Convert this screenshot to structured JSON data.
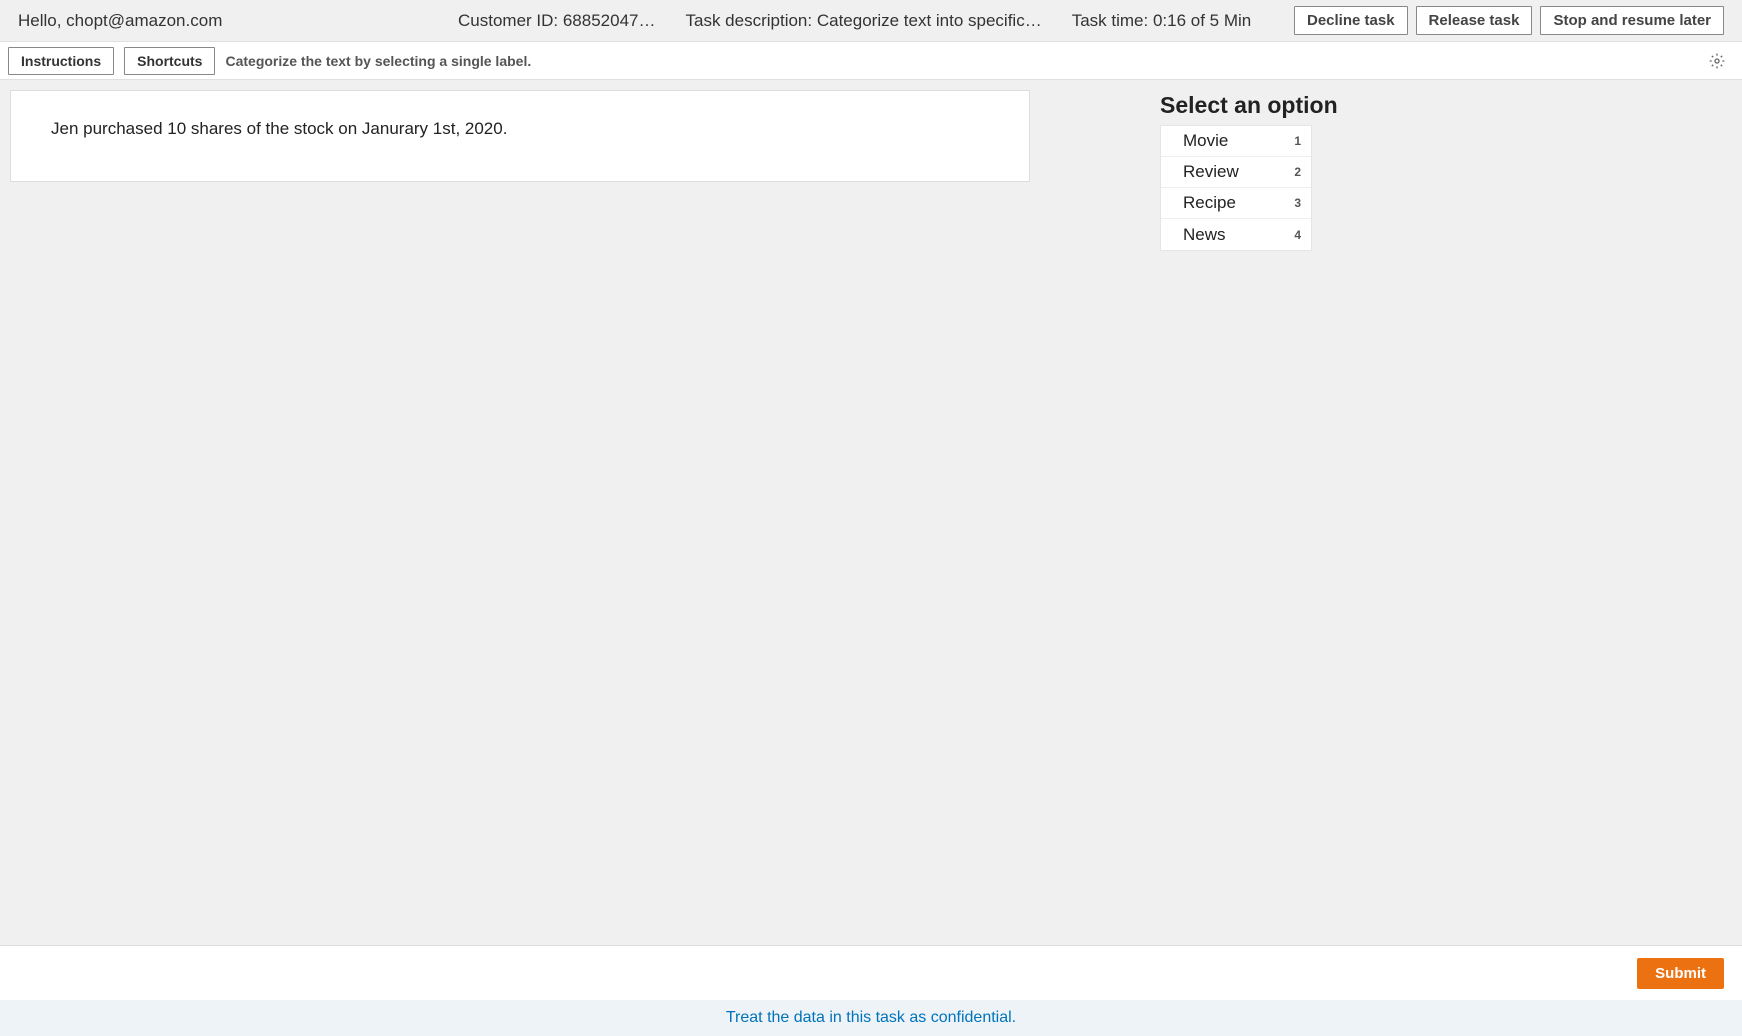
{
  "topbar": {
    "greeting": "Hello, chopt@amazon.com",
    "customer_id": "Customer ID: 68852047…",
    "task_description": "Task description: Categorize text into specific…",
    "task_time": "Task time: 0:16 of 5 Min",
    "decline_label": "Decline task",
    "release_label": "Release task",
    "stop_label": "Stop and resume later"
  },
  "secondary": {
    "instructions_label": "Instructions",
    "shortcuts_label": "Shortcuts",
    "instruction_text": "Categorize the text by selecting a single label."
  },
  "main": {
    "text_content": "Jen purchased 10 shares of the stock on Janurary 1st, 2020."
  },
  "options": {
    "title": "Select an option",
    "items": [
      {
        "label": "Movie",
        "shortcut": "1"
      },
      {
        "label": "Review",
        "shortcut": "2"
      },
      {
        "label": "Recipe",
        "shortcut": "3"
      },
      {
        "label": "News",
        "shortcut": "4"
      }
    ]
  },
  "submit": {
    "label": "Submit"
  },
  "footer": {
    "text": "Treat the data in this task as confidential."
  }
}
